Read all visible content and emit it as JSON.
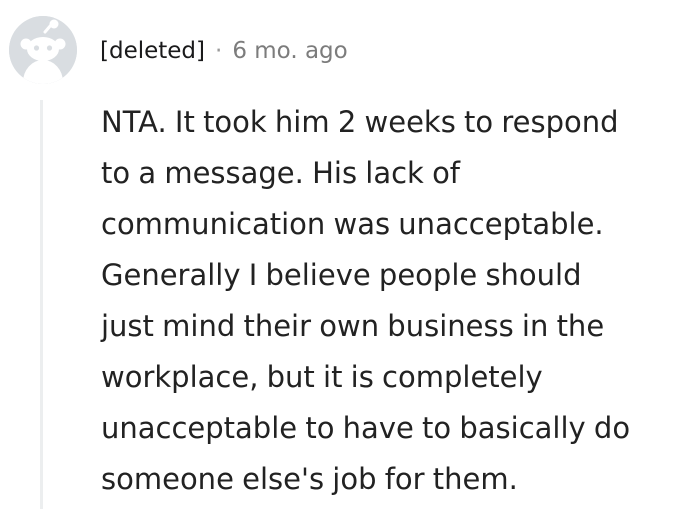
{
  "comment": {
    "author": "[deleted]",
    "separator": "·",
    "timestamp": "6 mo. ago",
    "avatar_icon": "deleted-user-avatar-icon",
    "body_lines": [
      "NTA. It took him 2 weeks to respond",
      "to a message. His lack of",
      "communication was unacceptable.",
      "Generally I believe people should",
      "just mind their own business in the",
      "workplace, but it is completely",
      "unacceptable to have to basically do",
      "someone else's job for them."
    ]
  },
  "colors": {
    "avatar_bg": "#d9dde1",
    "avatar_fg": "#ffffff",
    "meta_text": "#7c7c7c",
    "body_text": "#222222",
    "thread_line": "#eceeef"
  }
}
